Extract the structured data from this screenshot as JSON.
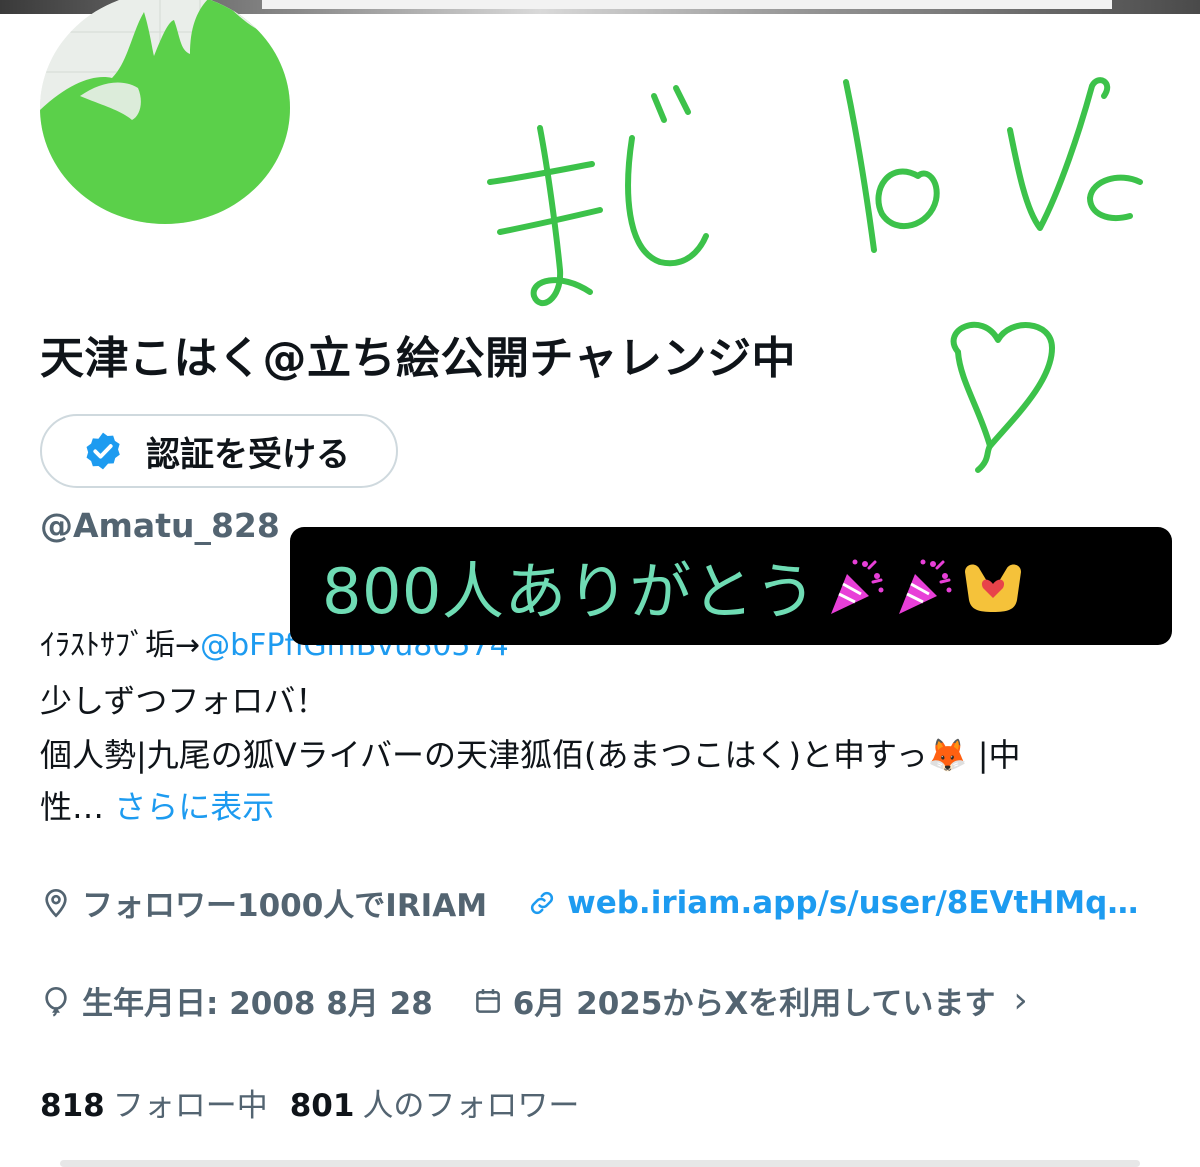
{
  "profile": {
    "display_name": "天津こはく@立ち絵公開チャレンジ中",
    "verify_label": "認証を受ける",
    "handle": "@Amatu_828"
  },
  "overlay": {
    "celebration_text": "800人ありがとう",
    "handwritten_text": "まじlove",
    "emoji_names": [
      "party-popper",
      "party-popper",
      "heart-hands"
    ],
    "celebration_text_color": "#6fdcb4",
    "doodle_color": "#3cc24a"
  },
  "bio": {
    "line1_prefix": "ｲﾗｽﾄｻﾌﾞ垢→",
    "line1_mention": "@bFPfiGmBvu80574",
    "line2": "少しずつフォロバ！",
    "line3": "個人勢|九尾の狐Vライバーの天津狐佰(あまつこはく)と申すっ🦊 |中",
    "line4_prefix": "性… ",
    "more_link": "さらに表示"
  },
  "meta": {
    "location": "フォロワー1000人でIRIAM",
    "website": "web.iriam.app/s/user/8EVtHMq…",
    "birthday": "生年月日: 2008 8月 28",
    "joined": "6月 2025からXを利用しています",
    "joined_chevron": "›"
  },
  "stats": {
    "following_count": "818",
    "following_label": "フォロー中",
    "followers_count": "801",
    "followers_label": "人のフォロワー"
  },
  "colors": {
    "accent": "#1d9bf0",
    "avatar_green": "#5bd04a",
    "secondary_text": "#536471"
  }
}
